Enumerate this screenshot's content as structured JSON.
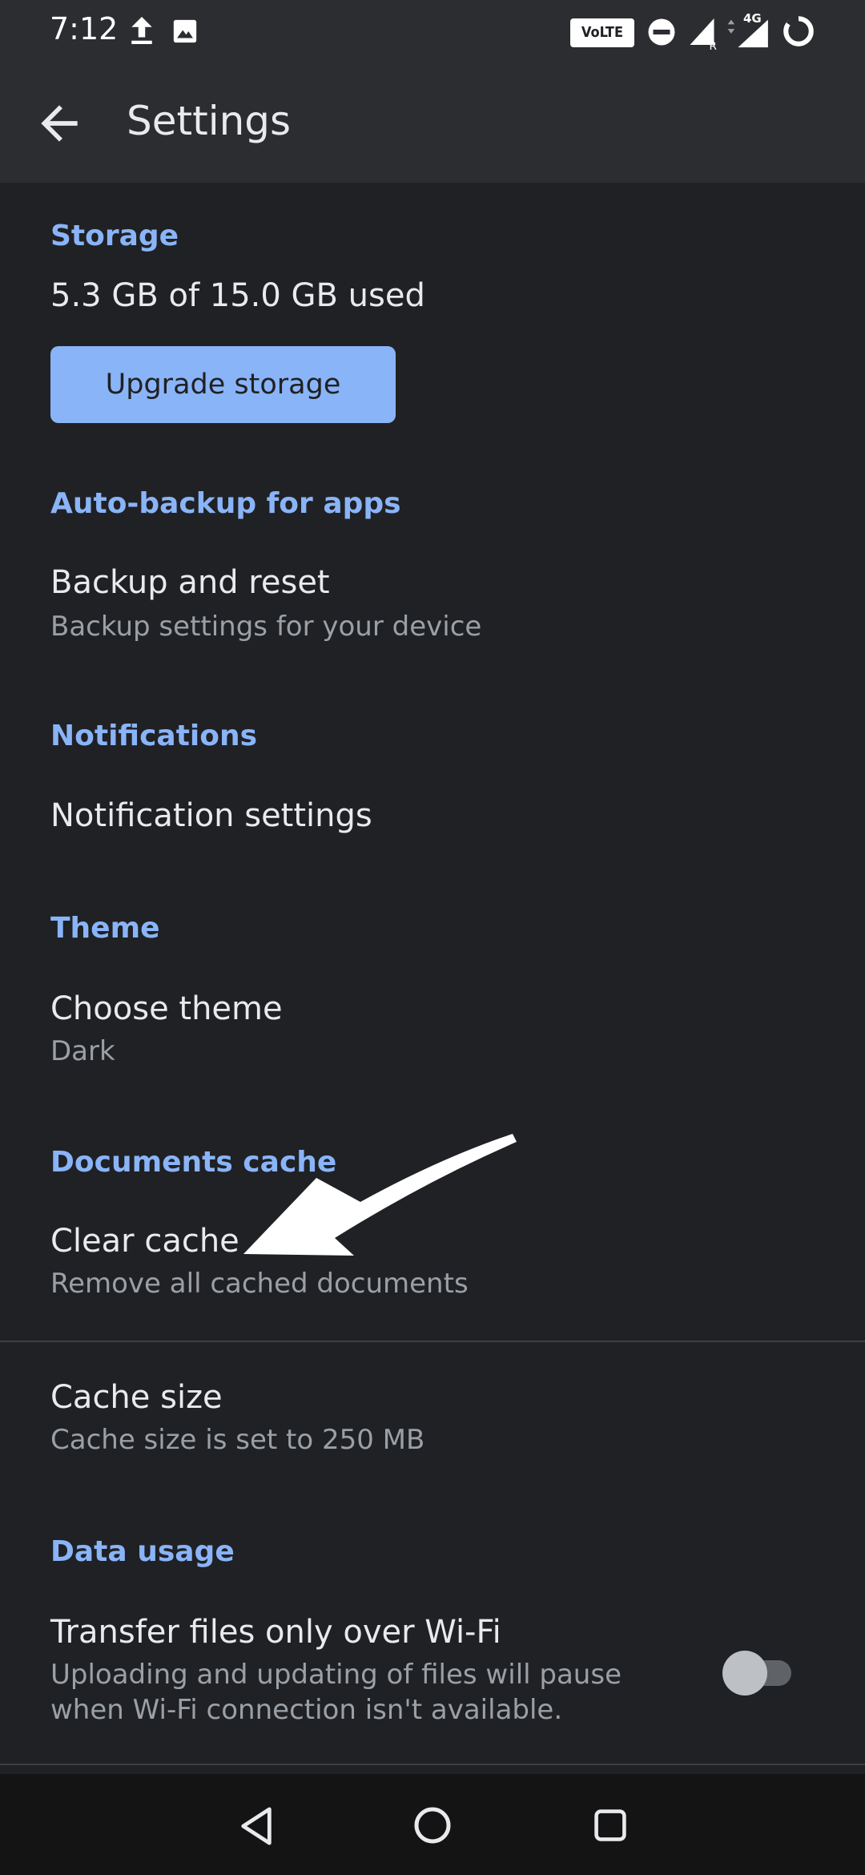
{
  "status_bar": {
    "time": "7:12",
    "volte_label": "VoLTE",
    "network_label": "4G",
    "icons": [
      "upload-icon",
      "image-icon",
      "do-not-disturb-icon",
      "signal-roaming-icon",
      "signal-4g-icon",
      "battery-icon"
    ]
  },
  "app_bar": {
    "title": "Settings",
    "back_icon": "arrow-back-icon"
  },
  "storage": {
    "header": "Storage",
    "used": "5.3 GB of 15.0 GB used",
    "upgrade_label": "Upgrade storage"
  },
  "auto_backup": {
    "header": "Auto-backup for apps",
    "title": "Backup and reset",
    "subtitle": "Backup settings for your device"
  },
  "notifications": {
    "header": "Notifications",
    "title": "Notification settings"
  },
  "theme": {
    "header": "Theme",
    "title": "Choose theme",
    "value": "Dark"
  },
  "documents_cache": {
    "header": "Documents cache",
    "clear_title": "Clear cache",
    "clear_subtitle": "Remove all cached documents",
    "size_title": "Cache size",
    "size_subtitle": "Cache size is set to 250 MB"
  },
  "data_usage": {
    "header": "Data usage",
    "wifi_title": "Transfer files only over Wi-Fi",
    "wifi_subtitle_line1": "Uploading and updating of files will pause",
    "wifi_subtitle_line2": "when Wi-Fi connection isn't available.",
    "wifi_only_enabled": false
  },
  "nav_bar": {
    "icons": [
      "nav-back-icon",
      "nav-home-icon",
      "nav-recents-icon"
    ]
  },
  "colors": {
    "background": "#202124",
    "app_bar": "#2c2d30",
    "accent": "#8ab4f8",
    "primary_text": "#e8eaed",
    "secondary_text": "#9aa0a6"
  }
}
